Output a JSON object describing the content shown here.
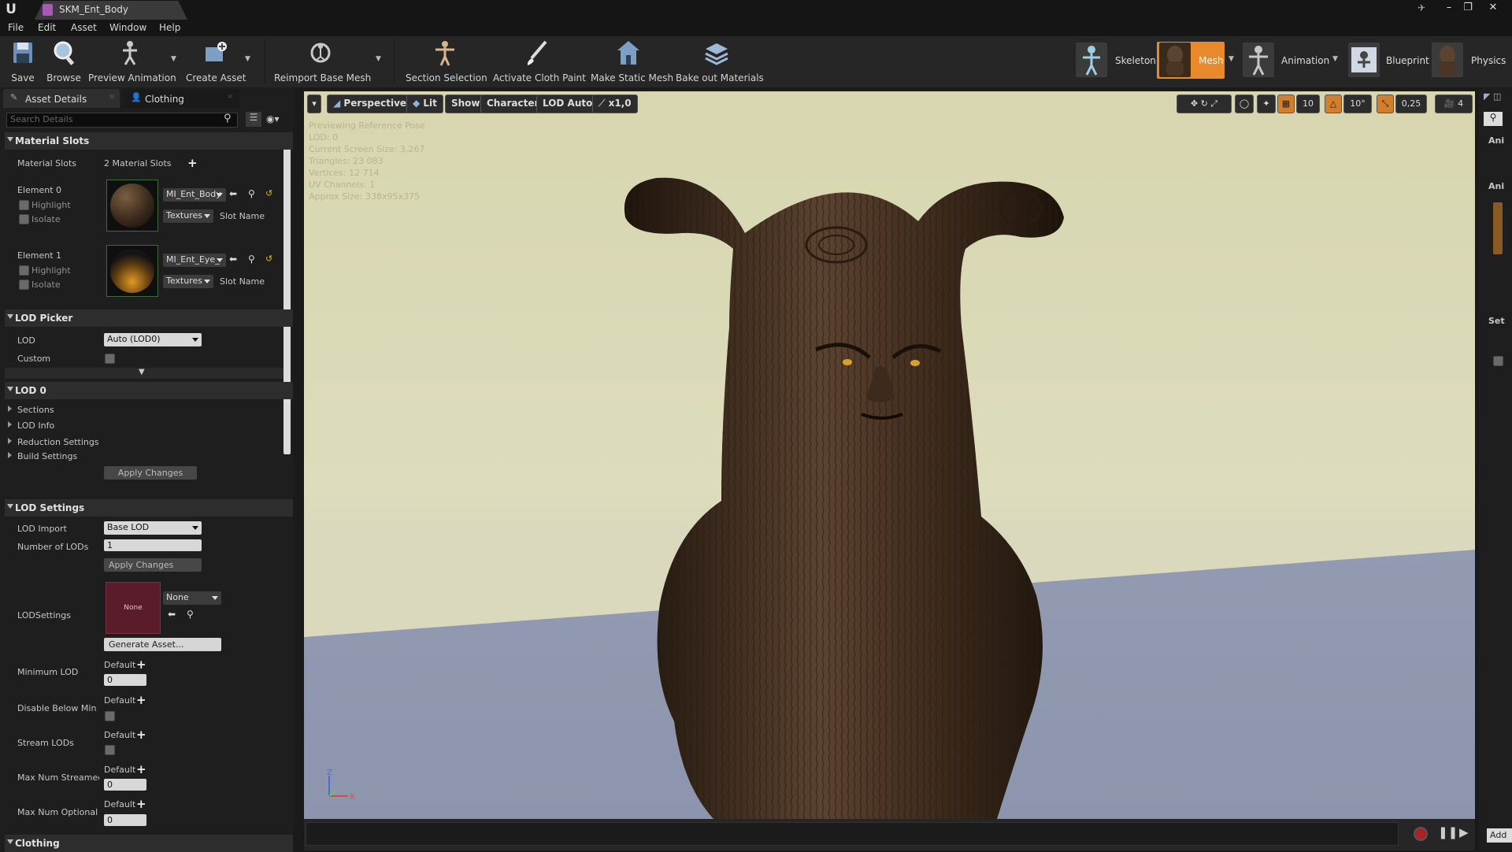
{
  "window": {
    "tab_title": "SKM_Ent_Body",
    "controls": [
      "–",
      "❐",
      "✕"
    ]
  },
  "menu": [
    "File",
    "Edit",
    "Asset",
    "Window",
    "Help"
  ],
  "toolbar": {
    "buttons": [
      {
        "label": "Save",
        "icon": "save-icon"
      },
      {
        "label": "Browse",
        "icon": "browse-icon"
      },
      {
        "label": "Preview Animation",
        "icon": "preview-animation-icon"
      },
      {
        "label": "Create Asset",
        "icon": "create-asset-icon"
      },
      {
        "label": "Reimport Base Mesh",
        "icon": "reimport-icon"
      },
      {
        "label": "Section Selection",
        "icon": "section-selection-icon"
      },
      {
        "label": "Activate Cloth Paint",
        "icon": "cloth-paint-icon"
      },
      {
        "label": "Make Static Mesh",
        "icon": "static-mesh-icon"
      },
      {
        "label": "Bake out Materials",
        "icon": "bake-materials-icon"
      }
    ],
    "modes": [
      {
        "label": "Skeleton",
        "active": false
      },
      {
        "label": "Mesh",
        "active": true
      },
      {
        "label": "Animation",
        "active": false
      },
      {
        "label": "Blueprint",
        "active": false
      },
      {
        "label": "Physics",
        "active": false
      }
    ],
    "accent_color": "#e8892c"
  },
  "left_panel": {
    "tabs": [
      "Asset Details",
      "Clothing"
    ],
    "search_placeholder": "Search Details",
    "material_slots": {
      "header": "Material Slots",
      "label": "Material Slots",
      "count_text": "2 Material Slots",
      "elements": [
        {
          "name": "Element 0",
          "highlight": "Highlight",
          "isolate": "Isolate",
          "material": "MI_Ent_Body",
          "textures": "Textures",
          "slot_name": "Slot Name"
        },
        {
          "name": "Element 1",
          "highlight": "Highlight",
          "isolate": "Isolate",
          "material": "MI_Ent_Eye_",
          "textures": "Textures",
          "slot_name": "Slot Name"
        }
      ]
    },
    "lod_picker": {
      "header": "LOD Picker",
      "lod_label": "LOD",
      "lod_value": "Auto (LOD0)",
      "custom_label": "Custom"
    },
    "lod0": {
      "header": "LOD 0",
      "items": [
        "Sections",
        "LOD Info",
        "Reduction Settings",
        "Build Settings"
      ],
      "apply": "Apply Changes"
    },
    "lod_settings": {
      "header": "LOD Settings",
      "lod_import_label": "LOD Import",
      "lod_import_value": "Base LOD",
      "num_lods_label": "Number of LODs",
      "num_lods_value": "1",
      "apply": "Apply Changes",
      "lodsettings_label": "LODSettings",
      "thumb_text": "None",
      "none_value": "None",
      "generate": "Generate Asset...",
      "rows": [
        {
          "label": "Minimum LOD",
          "default": "Default",
          "value": "0",
          "type": "number"
        },
        {
          "label": "Disable Below Min Lo",
          "default": "Default",
          "type": "checkbox"
        },
        {
          "label": "Stream LODs",
          "default": "Default",
          "type": "checkbox"
        },
        {
          "label": "Max Num Streamed",
          "default": "Default",
          "value": "0",
          "type": "number"
        },
        {
          "label": "Max Num Optional L",
          "default": "Default",
          "value": "0",
          "type": "number"
        }
      ]
    },
    "clothing_header": "Clothing"
  },
  "viewport": {
    "buttons": [
      "Perspective",
      "Lit",
      "Show",
      "Character",
      "LOD Auto",
      "x1,0"
    ],
    "right_controls": {
      "grid_snap": "10",
      "rotation_snap": "10°",
      "scale_snap": "0,25",
      "camera_speed": "4"
    },
    "stats": [
      "Previewing Reference Pose",
      "LOD: 0",
      "Current Screen Size: 3,267",
      "Triangles: 23 083",
      "Vertices: 12 714",
      "UV Channels: 1",
      "Approx Size: 338x95x375"
    ],
    "axis": {
      "z": "Z",
      "x": "X"
    }
  },
  "right_strip": {
    "labels": [
      "Ani",
      "Ani",
      "Set"
    ],
    "add_button": "Add"
  }
}
